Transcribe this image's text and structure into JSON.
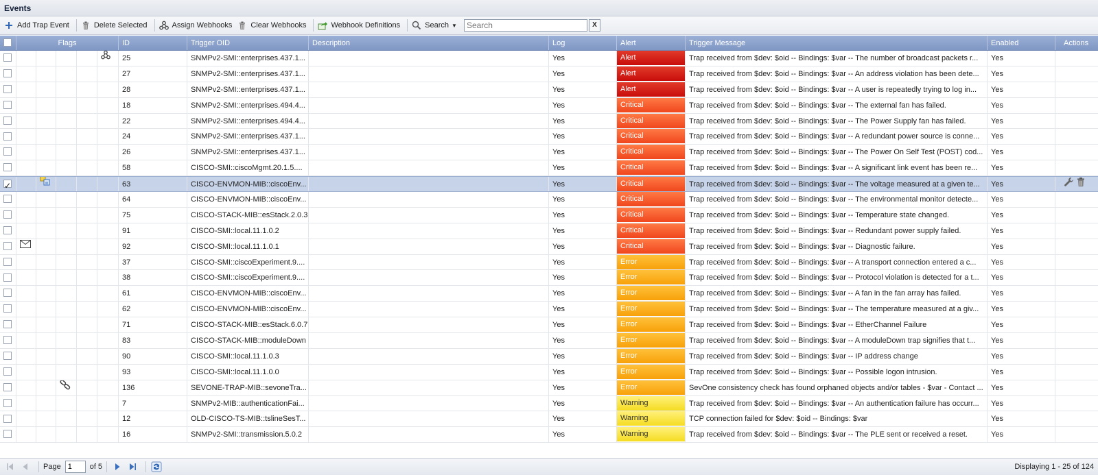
{
  "window": {
    "title": "Events"
  },
  "toolbar": {
    "add_label": "Add Trap Event",
    "delete_label": "Delete Selected",
    "assign_label": "Assign Webhooks",
    "clear_label": "Clear Webhooks",
    "defs_label": "Webhook Definitions",
    "search_label": "Search",
    "search_placeholder": "Search",
    "clear_search_label": "X"
  },
  "columns": {
    "flags": "Flags",
    "id": "ID",
    "oid": "Trigger OID",
    "desc": "Description",
    "log": "Log",
    "alert": "Alert",
    "msg": "Trigger Message",
    "enabled": "Enabled",
    "actions": "Actions"
  },
  "rows": [
    {
      "id": "25",
      "oid": "SNMPv2-SMI::enterprises.437.1...",
      "desc": "",
      "log": "Yes",
      "alert": "Alert",
      "sev": "alert",
      "msg": "Trap received from $dev: $oid -- Bindings: $var -- The number of broadcast packets r...",
      "enabled": "Yes",
      "flag": "webhook-icon",
      "flagcol": 5,
      "checked": false
    },
    {
      "id": "27",
      "oid": "SNMPv2-SMI::enterprises.437.1...",
      "desc": "",
      "log": "Yes",
      "alert": "Alert",
      "sev": "alert",
      "msg": "Trap received from $dev: $oid -- Bindings: $var -- An address violation has been dete...",
      "enabled": "Yes",
      "flag": "",
      "flagcol": 0,
      "checked": false
    },
    {
      "id": "28",
      "oid": "SNMPv2-SMI::enterprises.437.1...",
      "desc": "",
      "log": "Yes",
      "alert": "Alert",
      "sev": "alert",
      "msg": "Trap received from $dev: $oid -- Bindings: $var -- A user is repeatedly trying to log in...",
      "enabled": "Yes",
      "flag": "",
      "flagcol": 0,
      "checked": false
    },
    {
      "id": "18",
      "oid": "SNMPv2-SMI::enterprises.494.4...",
      "desc": "",
      "log": "Yes",
      "alert": "Critical",
      "sev": "critical",
      "msg": "Trap received from $dev: $oid -- Bindings: $var -- The external fan has failed.",
      "enabled": "Yes",
      "flag": "",
      "flagcol": 0,
      "checked": false
    },
    {
      "id": "22",
      "oid": "SNMPv2-SMI::enterprises.494.4...",
      "desc": "",
      "log": "Yes",
      "alert": "Critical",
      "sev": "critical",
      "msg": "Trap received from $dev: $oid -- Bindings: $var -- The Power Supply fan has failed.",
      "enabled": "Yes",
      "flag": "",
      "flagcol": 0,
      "checked": false
    },
    {
      "id": "24",
      "oid": "SNMPv2-SMI::enterprises.437.1...",
      "desc": "",
      "log": "Yes",
      "alert": "Critical",
      "sev": "critical",
      "msg": "Trap received from $dev: $oid -- Bindings: $var -- A redundant power source is conne...",
      "enabled": "Yes",
      "flag": "",
      "flagcol": 0,
      "checked": false
    },
    {
      "id": "26",
      "oid": "SNMPv2-SMI::enterprises.437.1...",
      "desc": "",
      "log": "Yes",
      "alert": "Critical",
      "sev": "critical",
      "msg": "Trap received from $dev: $oid -- Bindings: $var -- The Power On Self Test (POST) cod...",
      "enabled": "Yes",
      "flag": "",
      "flagcol": 0,
      "checked": false
    },
    {
      "id": "58",
      "oid": "CISCO-SMI::ciscoMgmt.20.1.5....",
      "desc": "",
      "log": "Yes",
      "alert": "Critical",
      "sev": "critical",
      "msg": "Trap received from $dev: $oid -- Bindings: $var -- A significant link event has been re...",
      "enabled": "Yes",
      "flag": "",
      "flagcol": 0,
      "checked": false
    },
    {
      "id": "63",
      "oid": "CISCO-ENVMON-MIB::ciscoEnv...",
      "desc": "",
      "log": "Yes",
      "alert": "Critical",
      "sev": "critical",
      "msg": "Trap received from $dev: $oid -- Bindings: $var -- The voltage measured at a given te...",
      "enabled": "Yes",
      "flag": "policy-icon",
      "flagcol": 2,
      "checked": true
    },
    {
      "id": "64",
      "oid": "CISCO-ENVMON-MIB::ciscoEnv...",
      "desc": "",
      "log": "Yes",
      "alert": "Critical",
      "sev": "critical",
      "msg": "Trap received from $dev: $oid -- Bindings: $var -- The environmental monitor detecte...",
      "enabled": "Yes",
      "flag": "",
      "flagcol": 0,
      "checked": false
    },
    {
      "id": "75",
      "oid": "CISCO-STACK-MIB::esStack.2.0.3",
      "desc": "",
      "log": "Yes",
      "alert": "Critical",
      "sev": "critical",
      "msg": "Trap received from $dev: $oid -- Bindings: $var -- Temperature state changed.",
      "enabled": "Yes",
      "flag": "",
      "flagcol": 0,
      "checked": false
    },
    {
      "id": "91",
      "oid": "CISCO-SMI::local.11.1.0.2",
      "desc": "",
      "log": "Yes",
      "alert": "Critical",
      "sev": "critical",
      "msg": "Trap received from $dev: $oid -- Bindings: $var -- Redundant power supply failed.",
      "enabled": "Yes",
      "flag": "",
      "flagcol": 0,
      "checked": false
    },
    {
      "id": "92",
      "oid": "CISCO-SMI::local.11.1.0.1",
      "desc": "",
      "log": "Yes",
      "alert": "Critical",
      "sev": "critical",
      "msg": "Trap received from $dev: $oid -- Bindings: $var -- Diagnostic failure.",
      "enabled": "Yes",
      "flag": "mail-icon",
      "flagcol": 1,
      "checked": false
    },
    {
      "id": "37",
      "oid": "CISCO-SMI::ciscoExperiment.9....",
      "desc": "",
      "log": "Yes",
      "alert": "Error",
      "sev": "error",
      "msg": "Trap received from $dev: $oid -- Bindings: $var -- A transport connection entered a c...",
      "enabled": "Yes",
      "flag": "",
      "flagcol": 0,
      "checked": false
    },
    {
      "id": "38",
      "oid": "CISCO-SMI::ciscoExperiment.9....",
      "desc": "",
      "log": "Yes",
      "alert": "Error",
      "sev": "error",
      "msg": "Trap received from $dev: $oid -- Bindings: $var -- Protocol violation is detected for a t...",
      "enabled": "Yes",
      "flag": "",
      "flagcol": 0,
      "checked": false
    },
    {
      "id": "61",
      "oid": "CISCO-ENVMON-MIB::ciscoEnv...",
      "desc": "",
      "log": "Yes",
      "alert": "Error",
      "sev": "error",
      "msg": "Trap received from $dev: $oid -- Bindings: $var -- A fan in the fan array has failed.",
      "enabled": "Yes",
      "flag": "",
      "flagcol": 0,
      "checked": false
    },
    {
      "id": "62",
      "oid": "CISCO-ENVMON-MIB::ciscoEnv...",
      "desc": "",
      "log": "Yes",
      "alert": "Error",
      "sev": "error",
      "msg": "Trap received from $dev: $oid -- Bindings: $var -- The temperature measured at a giv...",
      "enabled": "Yes",
      "flag": "",
      "flagcol": 0,
      "checked": false
    },
    {
      "id": "71",
      "oid": "CISCO-STACK-MIB::esStack.6.0.7",
      "desc": "",
      "log": "Yes",
      "alert": "Error",
      "sev": "error",
      "msg": "Trap received from $dev: $oid -- Bindings: $var -- EtherChannel Failure",
      "enabled": "Yes",
      "flag": "",
      "flagcol": 0,
      "checked": false
    },
    {
      "id": "83",
      "oid": "CISCO-STACK-MIB::moduleDown",
      "desc": "",
      "log": "Yes",
      "alert": "Error",
      "sev": "error",
      "msg": "Trap received from $dev: $oid -- Bindings: $var -- A moduleDown trap signifies that t...",
      "enabled": "Yes",
      "flag": "",
      "flagcol": 0,
      "checked": false
    },
    {
      "id": "90",
      "oid": "CISCO-SMI::local.11.1.0.3",
      "desc": "",
      "log": "Yes",
      "alert": "Error",
      "sev": "error",
      "msg": "Trap received from $dev: $oid -- Bindings: $var -- IP address change",
      "enabled": "Yes",
      "flag": "",
      "flagcol": 0,
      "checked": false
    },
    {
      "id": "93",
      "oid": "CISCO-SMI::local.11.1.0.0",
      "desc": "",
      "log": "Yes",
      "alert": "Error",
      "sev": "error",
      "msg": "Trap received from $dev: $oid -- Bindings: $var -- Possible logon intrusion.",
      "enabled": "Yes",
      "flag": "",
      "flagcol": 0,
      "checked": false
    },
    {
      "id": "136",
      "oid": "SEVONE-TRAP-MIB::sevoneTra...",
      "desc": "",
      "log": "Yes",
      "alert": "Error",
      "sev": "error",
      "msg": "SevOne consistency check has found orphaned objects and/or tables - $var - Contact ...",
      "enabled": "Yes",
      "flag": "link-icon",
      "flagcol": 3,
      "checked": false
    },
    {
      "id": "7",
      "oid": "SNMPv2-MIB::authenticationFai...",
      "desc": "",
      "log": "Yes",
      "alert": "Warning",
      "sev": "warning",
      "msg": "Trap received from $dev: $oid -- Bindings: $var -- An authentication failure has occurr...",
      "enabled": "Yes",
      "flag": "",
      "flagcol": 0,
      "checked": false
    },
    {
      "id": "12",
      "oid": "OLD-CISCO-TS-MIB::tslineSesT...",
      "desc": "",
      "log": "Yes",
      "alert": "Warning",
      "sev": "warning",
      "msg": "TCP connection failed for $dev: $oid -- Bindings: $var",
      "enabled": "Yes",
      "flag": "",
      "flagcol": 0,
      "checked": false
    },
    {
      "id": "16",
      "oid": "SNMPv2-SMI::transmission.5.0.2",
      "desc": "",
      "log": "Yes",
      "alert": "Warning",
      "sev": "warning",
      "msg": "Trap received from $dev: $oid -- Bindings: $var -- The PLE sent or received a reset.",
      "enabled": "Yes",
      "flag": "",
      "flagcol": 0,
      "checked": false
    }
  ],
  "pager": {
    "page_label": "Page",
    "page_value": "1",
    "of_label": "of 5",
    "display_info": "Displaying 1 - 25 of 124"
  }
}
